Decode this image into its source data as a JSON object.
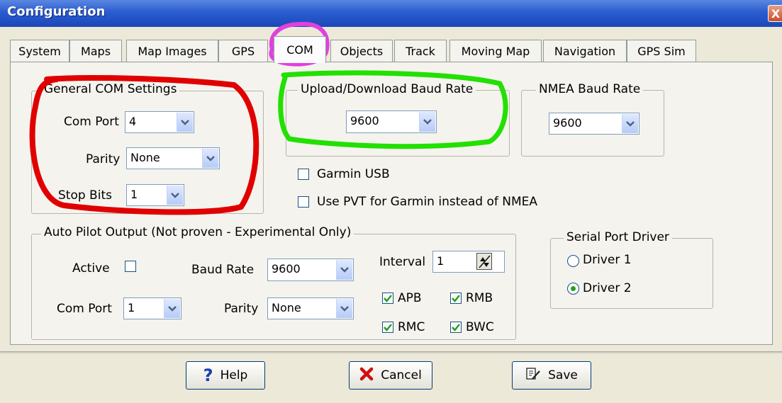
{
  "window": {
    "title": "Configuration",
    "close_symbol": "X"
  },
  "tabs": [
    {
      "label": "System"
    },
    {
      "label": "Maps"
    },
    {
      "label": "Map Images"
    },
    {
      "label": "GPS"
    },
    {
      "label": "COM",
      "active": true
    },
    {
      "label": "Objects"
    },
    {
      "label": "Track"
    },
    {
      "label": "Moving Map"
    },
    {
      "label": "Navigation"
    },
    {
      "label": "GPS Sim"
    }
  ],
  "general_com": {
    "legend": "General COM Settings",
    "com_port_label": "Com Port",
    "com_port_value": "4",
    "parity_label": "Parity",
    "parity_value": "None",
    "stop_bits_label": "Stop Bits",
    "stop_bits_value": "1"
  },
  "upload_download": {
    "legend": "Upload/Download Baud Rate",
    "value": "9600"
  },
  "nmea": {
    "legend": "NMEA Baud Rate",
    "value": "9600"
  },
  "garmin_usb": {
    "label": "Garmin USB",
    "checked": false
  },
  "use_pvt": {
    "label": "Use PVT for Garmin instead of NMEA",
    "checked": false
  },
  "autopilot": {
    "legend": "Auto Pilot Output  (Not proven - Experimental Only)",
    "active_label": "Active",
    "active_checked": false,
    "baud_label": "Baud Rate",
    "baud_value": "9600",
    "interval_label": "Interval",
    "interval_value": "1",
    "com_port_label": "Com Port",
    "com_port_value": "1",
    "parity_label": "Parity",
    "parity_value": "None",
    "sentences": [
      {
        "label": "APB",
        "checked": true
      },
      {
        "label": "RMB",
        "checked": true
      },
      {
        "label": "RMC",
        "checked": true
      },
      {
        "label": "BWC",
        "checked": true
      }
    ]
  },
  "serial_driver": {
    "legend": "Serial Port Driver",
    "options": [
      {
        "label": "Driver 1",
        "selected": false
      },
      {
        "label": "Driver 2",
        "selected": true
      }
    ]
  },
  "buttons": {
    "help": "Help",
    "cancel": "Cancel",
    "save": "Save"
  },
  "icons": {
    "help": "question-mark-icon",
    "cancel": "red-x-icon",
    "save": "save-pen-icon",
    "dropdown": "chevron-down-icon",
    "spinner": "spinner-arrows-icon"
  },
  "colors": {
    "titlebar": "#2a5cd0",
    "dialog_bg": "#ece9d8",
    "pane_bg": "#f4f3ee",
    "annotation_red": "#e00000",
    "annotation_green": "#22e000",
    "annotation_magenta": "#e040e0"
  }
}
